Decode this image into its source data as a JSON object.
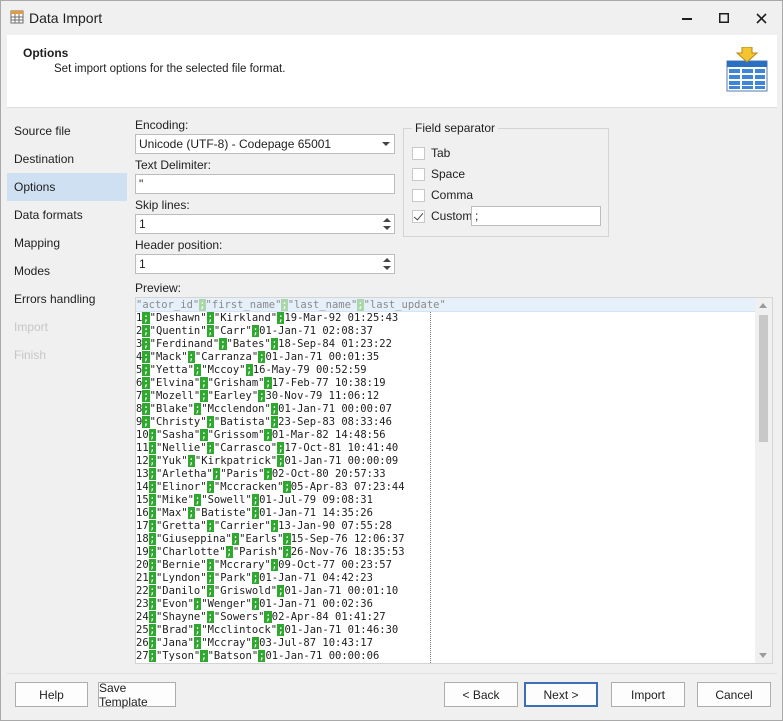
{
  "window": {
    "title": "Data Import",
    "icon": "table-grid-icon",
    "controls": {
      "minimize": "minimize-icon",
      "maximize": "maximize-icon",
      "close": "close-icon"
    }
  },
  "header": {
    "title": "Options",
    "subtitle": "Set import options for the selected file format."
  },
  "sidebar": {
    "items": [
      {
        "label": "Source file",
        "state": "normal"
      },
      {
        "label": "Destination",
        "state": "normal"
      },
      {
        "label": "Options",
        "state": "active"
      },
      {
        "label": "Data formats",
        "state": "normal"
      },
      {
        "label": "Mapping",
        "state": "normal"
      },
      {
        "label": "Modes",
        "state": "normal"
      },
      {
        "label": "Errors handling",
        "state": "normal"
      },
      {
        "label": "Import",
        "state": "disabled"
      },
      {
        "label": "Finish",
        "state": "disabled"
      }
    ]
  },
  "options": {
    "encoding_label": "Encoding:",
    "encoding_value": "Unicode (UTF-8) - Codepage 65001",
    "text_delimiter_label": "Text Delimiter:",
    "text_delimiter_value": "\"",
    "skip_lines_label": "Skip lines:",
    "skip_lines_value": "1",
    "header_position_label": "Header position:",
    "header_position_value": "1"
  },
  "field_separator": {
    "title": "Field separator",
    "tab": {
      "label": "Tab",
      "checked": false
    },
    "space": {
      "label": "Space",
      "checked": false
    },
    "comma": {
      "label": "Comma",
      "checked": false
    },
    "custom": {
      "label": "Custom",
      "checked": true,
      "value": ";"
    }
  },
  "preview": {
    "label": "Preview:",
    "separator": ";",
    "header_fields": [
      "\"actor_id\"",
      "\"first_name\"",
      "\"last_name\"",
      "\"last_update\""
    ],
    "rows": [
      [
        "1",
        "\"Deshawn\"",
        "\"Kirkland\"",
        "19-Mar-92 01:25:43"
      ],
      [
        "2",
        "\"Quentin\"",
        "\"Carr\"",
        "01-Jan-71 02:08:37"
      ],
      [
        "3",
        "\"Ferdinand\"",
        "\"Bates\"",
        "18-Sep-84 01:23:22"
      ],
      [
        "4",
        "\"Mack\"",
        "\"Carranza\"",
        "01-Jan-71 00:01:35"
      ],
      [
        "5",
        "\"Yetta\"",
        "\"Mccoy\"",
        "16-May-79 00:52:59"
      ],
      [
        "6",
        "\"Elvina\"",
        "\"Grisham\"",
        "17-Feb-77 10:38:19"
      ],
      [
        "7",
        "\"Mozell\"",
        "\"Earley\"",
        "30-Nov-79 11:06:12"
      ],
      [
        "8",
        "\"Blake\"",
        "\"Mcclendon\"",
        "01-Jan-71 00:00:07"
      ],
      [
        "9",
        "\"Christy\"",
        "\"Batista\"",
        "23-Sep-83 08:33:46"
      ],
      [
        "10",
        "\"Sasha\"",
        "\"Grissom\"",
        "01-Mar-82 14:48:56"
      ],
      [
        "11",
        "\"Nellie\"",
        "\"Carrasco\"",
        "17-Oct-81 10:41:40"
      ],
      [
        "12",
        "\"Yuk\"",
        "\"Kirkpatrick\"",
        "01-Jan-71 00:00:09"
      ],
      [
        "13",
        "\"Arletha\"",
        "\"Paris\"",
        "02-Oct-80 20:57:33"
      ],
      [
        "14",
        "\"Elinor\"",
        "\"Mccracken\"",
        "05-Apr-83 07:23:44"
      ],
      [
        "15",
        "\"Mike\"",
        "\"Sowell\"",
        "01-Jul-79 09:08:31"
      ],
      [
        "16",
        "\"Max\"",
        "\"Batiste\"",
        "01-Jan-71 14:35:26"
      ],
      [
        "17",
        "\"Gretta\"",
        "\"Carrier\"",
        "13-Jan-90 07:55:28"
      ],
      [
        "18",
        "\"Giuseppina\"",
        "\"Earls\"",
        "15-Sep-76 12:06:37"
      ],
      [
        "19",
        "\"Charlotte\"",
        "\"Parish\"",
        "26-Nov-76 18:35:53"
      ],
      [
        "20",
        "\"Bernie\"",
        "\"Mccrary\"",
        "09-Oct-77 00:23:57"
      ],
      [
        "21",
        "\"Lyndon\"",
        "\"Park\"",
        "01-Jan-71 04:42:23"
      ],
      [
        "22",
        "\"Danilo\"",
        "\"Griswold\"",
        "01-Jan-71 00:01:10"
      ],
      [
        "23",
        "\"Evon\"",
        "\"Wenger\"",
        "01-Jan-71 00:02:36"
      ],
      [
        "24",
        "\"Shayne\"",
        "\"Sowers\"",
        "02-Apr-84 01:41:27"
      ],
      [
        "25",
        "\"Brad\"",
        "\"Mcclintock\"",
        "01-Jan-71 01:46:30"
      ],
      [
        "26",
        "\"Jana\"",
        "\"Mccray\"",
        "03-Jul-87 10:43:17"
      ],
      [
        "27",
        "\"Tyson\"",
        "\"Batson\"",
        "01-Jan-71 00:00:06"
      ]
    ]
  },
  "footer": {
    "help": "Help",
    "save_template": "Save Template",
    "back": "< Back",
    "next": "Next >",
    "import": "Import",
    "cancel": "Cancel"
  },
  "colors": {
    "separator_highlight": "#2fa82f",
    "active_sidebar": "#cfe0f3",
    "default_button_border": "#3c6fb4"
  }
}
